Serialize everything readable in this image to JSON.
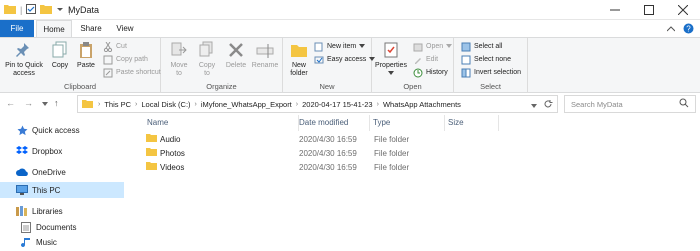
{
  "window": {
    "title": "MyData"
  },
  "tabs": {
    "file": "File",
    "home": "Home",
    "share": "Share",
    "view": "View"
  },
  "ribbon": {
    "clipboard": {
      "label": "Clipboard",
      "pin": "Pin to Quick access",
      "copy": "Copy",
      "paste": "Paste",
      "cut": "Cut",
      "copy_path": "Copy path",
      "paste_shortcut": "Paste shortcut"
    },
    "organize": {
      "label": "Organize",
      "move_to": "Move to",
      "copy_to": "Copy to",
      "delete": "Delete",
      "rename": "Rename"
    },
    "new": {
      "label": "New",
      "new_folder": "New folder",
      "new_item": "New item",
      "easy_access": "Easy access"
    },
    "open": {
      "label": "Open",
      "properties": "Properties",
      "open": "Open",
      "edit": "Edit",
      "history": "History"
    },
    "select": {
      "label": "Select",
      "select_all": "Select all",
      "select_none": "Select none",
      "invert_selection": "Invert selection"
    }
  },
  "address": {
    "crumbs": [
      "This PC",
      "Local Disk (C:)",
      "iMyfone_WhatsApp_Export",
      "2020-04-17 15-41-23",
      "WhatsApp Attachments"
    ]
  },
  "search": {
    "placeholder": "Search MyData"
  },
  "nav": {
    "items": [
      {
        "label": "Quick access",
        "icon": "star-icon"
      },
      {
        "label": "Dropbox",
        "icon": "dropbox-icon"
      },
      {
        "label": "OneDrive",
        "icon": "cloud-icon"
      },
      {
        "label": "This PC",
        "icon": "computer-icon"
      },
      {
        "label": "Libraries",
        "icon": "library-icon"
      },
      {
        "label": "Documents",
        "icon": "documents-icon"
      },
      {
        "label": "Music",
        "icon": "music-icon"
      }
    ]
  },
  "columns": {
    "name": "Name",
    "date": "Date modified",
    "type": "Type",
    "size": "Size"
  },
  "files": [
    {
      "name": "Audio",
      "date": "2020/4/30 16:59",
      "type": "File folder"
    },
    {
      "name": "Photos",
      "date": "2020/4/30 16:59",
      "type": "File folder"
    },
    {
      "name": "Videos",
      "date": "2020/4/30 16:59",
      "type": "File folder"
    }
  ],
  "colors": {
    "accent": "#1a6fc9",
    "selection": "#cce8ff",
    "folder": "#f4c542"
  }
}
